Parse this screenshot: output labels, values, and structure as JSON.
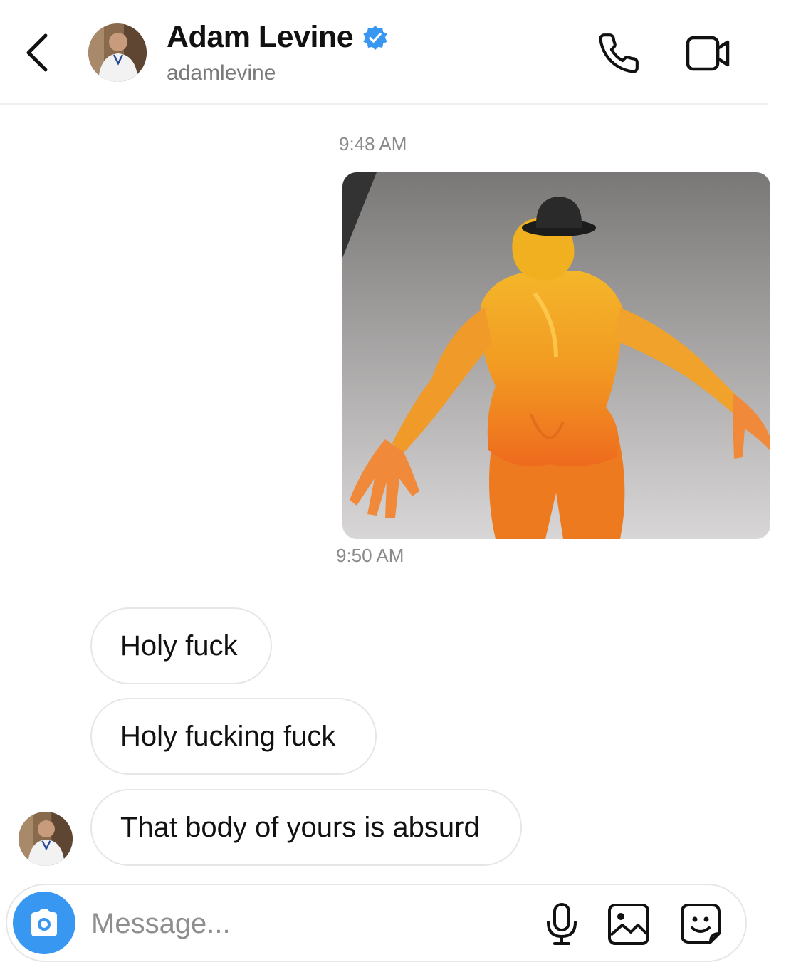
{
  "header": {
    "display_name": "Adam Levine",
    "username": "adamlevine",
    "verified": true,
    "icons": {
      "back": "chevron-left-icon",
      "call": "phone-icon",
      "video": "video-camera-icon",
      "verified": "verified-badge-icon"
    }
  },
  "conversation": {
    "timestamps": [
      "9:48 AM",
      "9:50 AM"
    ],
    "sent_photo": {
      "icon": "image"
    },
    "received_messages": [
      {
        "text": "Holy fuck"
      },
      {
        "text": "Holy fucking fuck"
      },
      {
        "text": "That body of yours is absurd"
      }
    ]
  },
  "composer": {
    "placeholder": "Message...",
    "icons": {
      "camera": "camera-icon",
      "mic": "microphone-icon",
      "gallery": "gallery-icon",
      "sticker": "sticker-icon"
    }
  },
  "colors": {
    "accent": "#3897f0",
    "verified": "#3897f0",
    "bubble_border": "#e6e6e6",
    "muted_text": "#8e8e8e"
  }
}
